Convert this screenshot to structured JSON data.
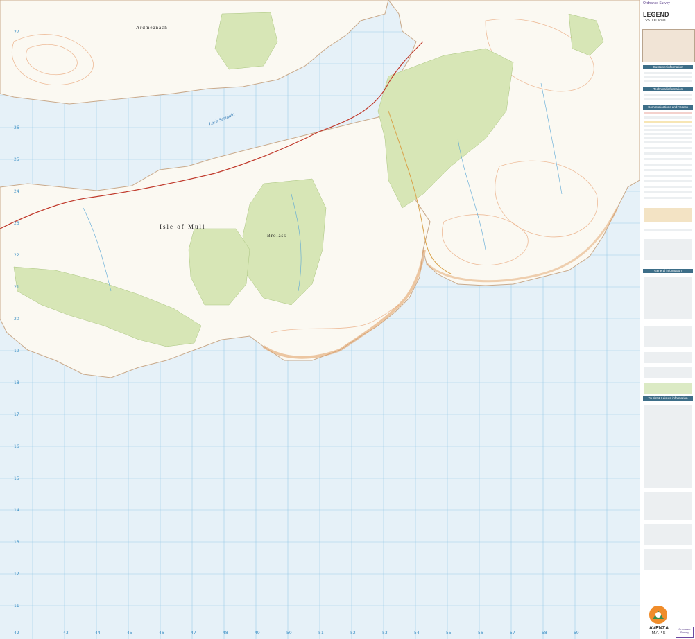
{
  "map": {
    "places": [
      {
        "id": "ardmeanach",
        "text": "Ardmeanach"
      },
      {
        "id": "isle-of-mull",
        "text": "Isle of Mull"
      },
      {
        "id": "brolass",
        "text": "Brolass"
      }
    ],
    "water": [
      {
        "id": "loch-scridain",
        "text": "Loch Scridain"
      }
    ],
    "grid_bottom": [
      "42",
      "43",
      "44",
      "45",
      "46",
      "47",
      "48",
      "49",
      "50",
      "51",
      "52",
      "53",
      "54",
      "55",
      "56",
      "57",
      "58",
      "59"
    ],
    "grid_side": [
      "27",
      "26",
      "25",
      "24",
      "23",
      "22",
      "21",
      "20",
      "19",
      "18",
      "17",
      "16",
      "15",
      "14",
      "13",
      "12",
      "11"
    ]
  },
  "legend": {
    "brand": "Ordnance Survey",
    "title": "LEGEND",
    "scale": "1:25 000 scale",
    "sections": [
      "Customer information",
      "Technical information",
      "Communications and Access",
      "General information",
      "Tourist & Leisure information"
    ]
  },
  "avenza": {
    "name": "AVENZA",
    "sub": "MAPS",
    "badge": "Ordnance Survey"
  },
  "colors": {
    "sea": "#e6f1f8",
    "land": "#fbf9f2",
    "forest": "#d7e6b6",
    "contour": "#e8a172",
    "section": "#3d6e88"
  }
}
